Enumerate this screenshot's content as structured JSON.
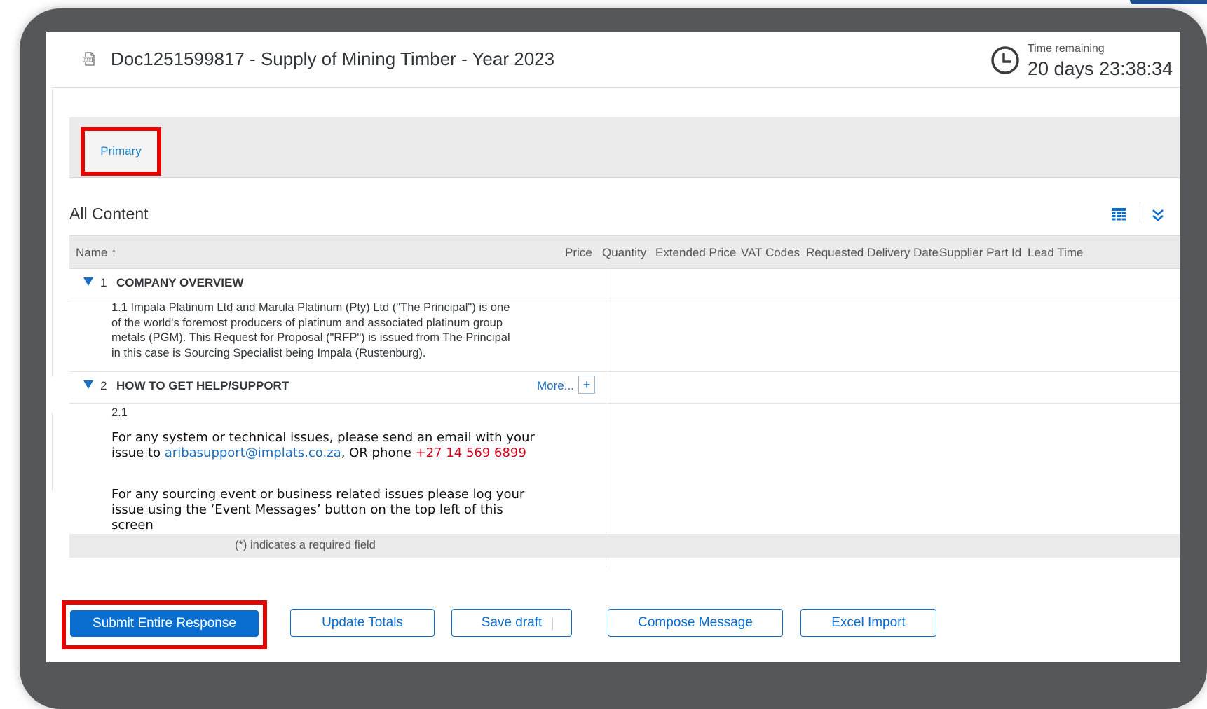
{
  "header": {
    "title": "Doc1251599817 - Supply of Mining Timber - Year 2023",
    "doc_icon_text": "RFP",
    "time_remaining_label": "Time remaining",
    "time_remaining_value": "20 days 23:38:34"
  },
  "tabs": [
    {
      "label": "Primary",
      "highlighted": true
    }
  ],
  "content": {
    "title": "All Content",
    "columns": [
      "Name ↑",
      "Price",
      "Quantity",
      "Extended Price",
      "VAT Codes",
      "Requested Delivery Date",
      "Supplier Part Id",
      "Lead Time"
    ],
    "sections": [
      {
        "number": "1",
        "title": "COMPANY OVERVIEW",
        "items": [
          {
            "text": "1.1  Impala Platinum Ltd and Marula Platinum (Pty) Ltd (\"The Principal\") is one of the world's foremost producers of platinum and associated platinum group metals (PGM).  This Request for Proposal (\"RFP\") is issued from The Principal in this case is Sourcing Specialist being Impala (Rustenburg)."
          }
        ]
      },
      {
        "number": "2",
        "title": "HOW TO GET HELP/SUPPORT",
        "more_label": "More...",
        "plus_label": "+",
        "items": [
          {
            "number": "2.1",
            "para1_before": "For any system or technical issues, please send an email with your issue to ",
            "email": "aribasupport@implats.co.za",
            "para1_middle": ", OR phone ",
            "phone": "+27 14 569 6899",
            "para2": "For any sourcing event or business related issues please log your issue using the ‘Event Messages’ button on the top left of this screen"
          }
        ]
      }
    ],
    "required_note": "(*) indicates a required field"
  },
  "buttons": {
    "submit": "Submit Entire Response",
    "update_totals": "Update Totals",
    "save_draft": "Save draft",
    "compose_message": "Compose Message",
    "excel_import": "Excel Import"
  },
  "colors": {
    "accent_blue": "#0a6ed1",
    "highlight_red": "#e10600",
    "phone_red": "#d0021b"
  }
}
